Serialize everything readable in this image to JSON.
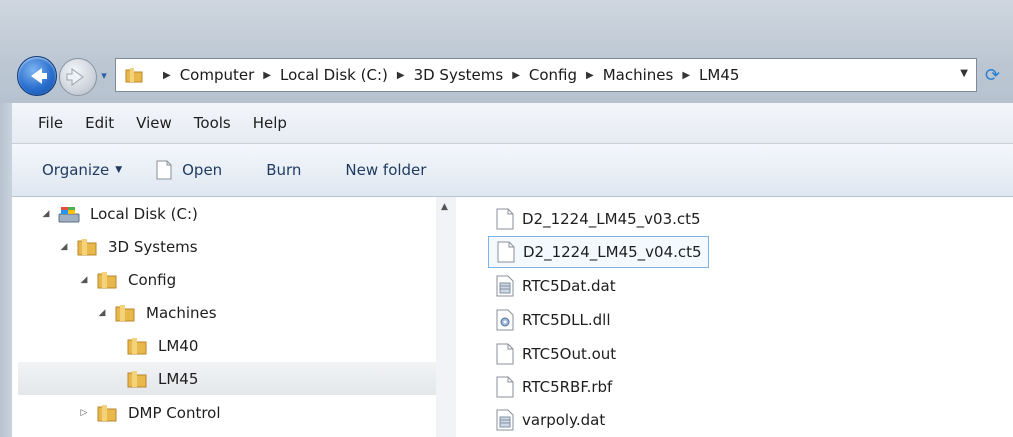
{
  "address": {
    "crumbs": [
      "Computer",
      "Local Disk (C:)",
      "3D Systems",
      "Config",
      "Machines",
      "LM45"
    ]
  },
  "menu": [
    "File",
    "Edit",
    "View",
    "Tools",
    "Help"
  ],
  "commands": {
    "organize": "Organize",
    "open": "Open",
    "burn": "Burn",
    "new_folder": "New folder"
  },
  "tree": [
    {
      "label": "Local Disk (C:)",
      "icon": "drive-icon",
      "level": 0,
      "state": "expanded"
    },
    {
      "label": "3D Systems",
      "icon": "folder-icon",
      "level": 1,
      "state": "expanded"
    },
    {
      "label": "Config",
      "icon": "folder-icon",
      "level": 2,
      "state": "expanded"
    },
    {
      "label": "Machines",
      "icon": "folder-icon",
      "level": 3,
      "state": "expanded"
    },
    {
      "label": "LM40",
      "icon": "folder-icon",
      "level": 4,
      "state": "none"
    },
    {
      "label": "LM45",
      "icon": "folder-icon",
      "level": 4,
      "state": "none",
      "selected": true
    },
    {
      "label": "DMP Control",
      "icon": "folder-icon",
      "level": 2,
      "state": "collapsed"
    }
  ],
  "files": [
    {
      "name": "D2_1224_LM45_v03.ct5",
      "icon": "document-icon"
    },
    {
      "name": "D2_1224_LM45_v04.ct5",
      "icon": "document-icon",
      "focused": true
    },
    {
      "name": "RTC5Dat.dat",
      "icon": "data-file-icon"
    },
    {
      "name": "RTC5DLL.dll",
      "icon": "dll-file-icon"
    },
    {
      "name": "RTC5Out.out",
      "icon": "document-icon"
    },
    {
      "name": "RTC5RBF.rbf",
      "icon": "document-icon"
    },
    {
      "name": "varpoly.dat",
      "icon": "data-file-icon"
    }
  ],
  "colors": {
    "accent": "#2a6fcf",
    "folder": "#e8b84a",
    "selection_border": "#7eb4ea"
  }
}
